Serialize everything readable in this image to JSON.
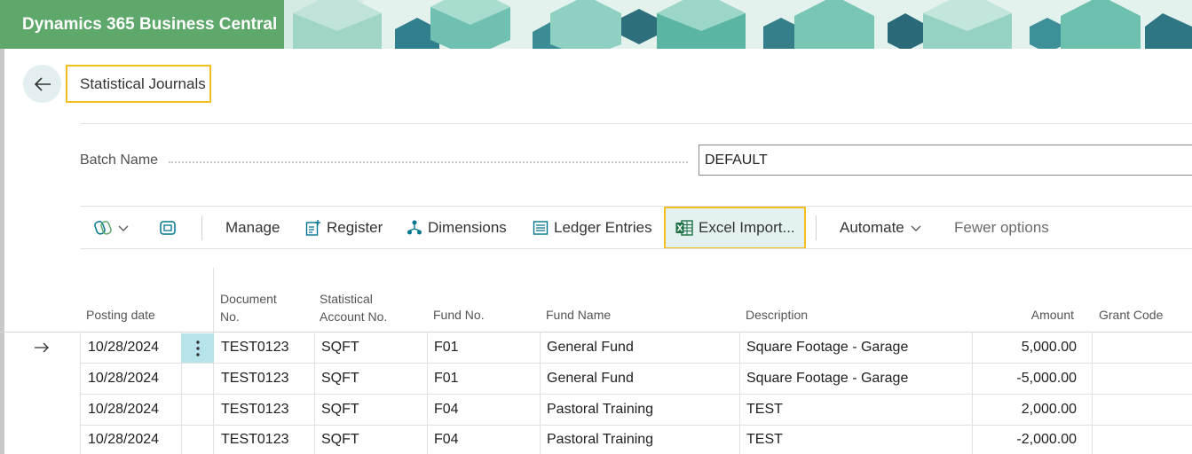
{
  "app": {
    "title": "Dynamics 365 Business Central"
  },
  "page": {
    "title": "Statistical Journals"
  },
  "batch": {
    "label": "Batch Name",
    "value": "DEFAULT"
  },
  "toolbar": {
    "manage": "Manage",
    "register": "Register",
    "dimensions": "Dimensions",
    "ledger_entries": "Ledger Entries",
    "excel_import": "Excel Import...",
    "automate": "Automate",
    "fewer_options": "Fewer options"
  },
  "columns": {
    "posting_date": "Posting date",
    "document_no_1": "Document",
    "document_no_2": "No.",
    "stat_account_1": "Statistical",
    "stat_account_2": "Account No.",
    "fund_no": "Fund No.",
    "fund_name": "Fund Name",
    "description": "Description",
    "amount": "Amount",
    "grant_code": "Grant Code"
  },
  "rows": [
    {
      "posting_date": "10/28/2024",
      "document_no": "TEST0123",
      "stat_account": "SQFT",
      "fund_no": "F01",
      "fund_name": "General Fund",
      "description": "Square Footage - Garage",
      "amount": "5,000.00"
    },
    {
      "posting_date": "10/28/2024",
      "document_no": "TEST0123",
      "stat_account": "SQFT",
      "fund_no": "F01",
      "fund_name": "General Fund",
      "description": "Square Footage - Garage",
      "amount": "-5,000.00"
    },
    {
      "posting_date": "10/28/2024",
      "document_no": "TEST0123",
      "stat_account": "SQFT",
      "fund_no": "F04",
      "fund_name": "Pastoral Training",
      "description": "TEST",
      "amount": "2,000.00"
    },
    {
      "posting_date": "10/28/2024",
      "document_no": "TEST0123",
      "stat_account": "SQFT",
      "fund_no": "F04",
      "fund_name": "Pastoral Training",
      "description": "TEST",
      "amount": "-2,000.00"
    }
  ],
  "colors": {
    "brand": "#5fa86c",
    "highlight": "#f2c01e",
    "accent": "#00758f",
    "selected_cell": "#b7e4ea"
  }
}
